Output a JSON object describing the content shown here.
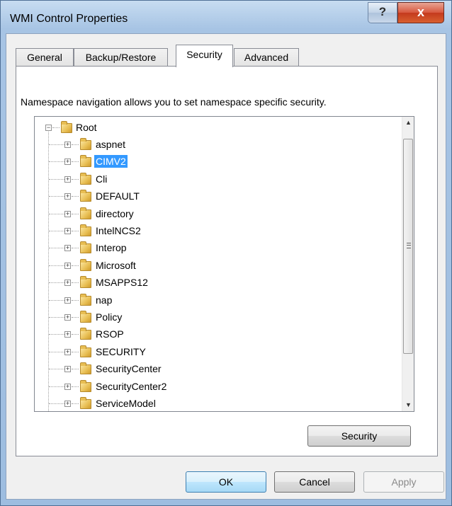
{
  "window": {
    "title": "WMI Control Properties",
    "help_label": "?",
    "close_label": "x"
  },
  "tabs": [
    {
      "label": "General",
      "active": false
    },
    {
      "label": "Backup/Restore",
      "active": false
    },
    {
      "label": "Security",
      "active": true
    },
    {
      "label": "Advanced",
      "active": false
    }
  ],
  "panel": {
    "description": "Namespace navigation allows you to set namespace specific security."
  },
  "tree": {
    "root": {
      "label": "Root",
      "expanded": true
    },
    "children": [
      {
        "label": "aspnet",
        "selected": false
      },
      {
        "label": "CIMV2",
        "selected": true
      },
      {
        "label": "Cli",
        "selected": false
      },
      {
        "label": "DEFAULT",
        "selected": false
      },
      {
        "label": "directory",
        "selected": false
      },
      {
        "label": "IntelNCS2",
        "selected": false
      },
      {
        "label": "Interop",
        "selected": false
      },
      {
        "label": "Microsoft",
        "selected": false
      },
      {
        "label": "MSAPPS12",
        "selected": false
      },
      {
        "label": "nap",
        "selected": false
      },
      {
        "label": "Policy",
        "selected": false
      },
      {
        "label": "RSOP",
        "selected": false
      },
      {
        "label": "SECURITY",
        "selected": false
      },
      {
        "label": "SecurityCenter",
        "selected": false
      },
      {
        "label": "SecurityCenter2",
        "selected": false
      },
      {
        "label": "ServiceModel",
        "selected": false
      }
    ]
  },
  "buttons": {
    "security": "Security",
    "ok": "OK",
    "cancel": "Cancel",
    "apply": "Apply"
  },
  "colors": {
    "selection": "#3399ff",
    "window_frame": "#a7c4e4",
    "close_button": "#c43a1d"
  }
}
